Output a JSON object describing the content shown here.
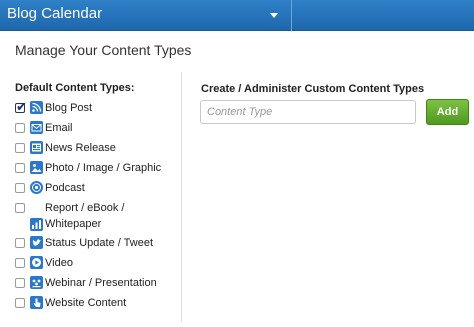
{
  "header": {
    "title": "Blog Calendar",
    "dropdown_icon": "chevron-down-icon"
  },
  "page": {
    "title": "Manage Your Content Types"
  },
  "default_types": {
    "heading": "Default Content Types:",
    "items": [
      {
        "label": "Blog Post",
        "checked": true,
        "icon": "rss-icon"
      },
      {
        "label": "Email",
        "checked": false,
        "icon": "envelope-icon"
      },
      {
        "label": "News Release",
        "checked": false,
        "icon": "newspaper-icon"
      },
      {
        "label": "Photo / Image / Graphic",
        "checked": false,
        "icon": "image-icon"
      },
      {
        "label": "Podcast",
        "checked": false,
        "icon": "podcast-icon"
      },
      {
        "label": "Report / eBook / Whitepaper",
        "checked": false,
        "icon": "bar-chart-icon"
      },
      {
        "label": "Status Update / Tweet",
        "checked": false,
        "icon": "bird-icon"
      },
      {
        "label": "Video",
        "checked": false,
        "icon": "play-icon"
      },
      {
        "label": "Webinar / Presentation",
        "checked": false,
        "icon": "presentation-icon"
      },
      {
        "label": "Website Content",
        "checked": false,
        "icon": "cursor-icon"
      }
    ]
  },
  "custom_types": {
    "heading": "Create / Administer Custom Content Types",
    "input_placeholder": "Content Type",
    "input_value": "",
    "add_label": "Add"
  },
  "colors": {
    "header_bg": "#2f80c8",
    "icon_bg": "#2a78c9",
    "add_button": "#5faa2c"
  }
}
